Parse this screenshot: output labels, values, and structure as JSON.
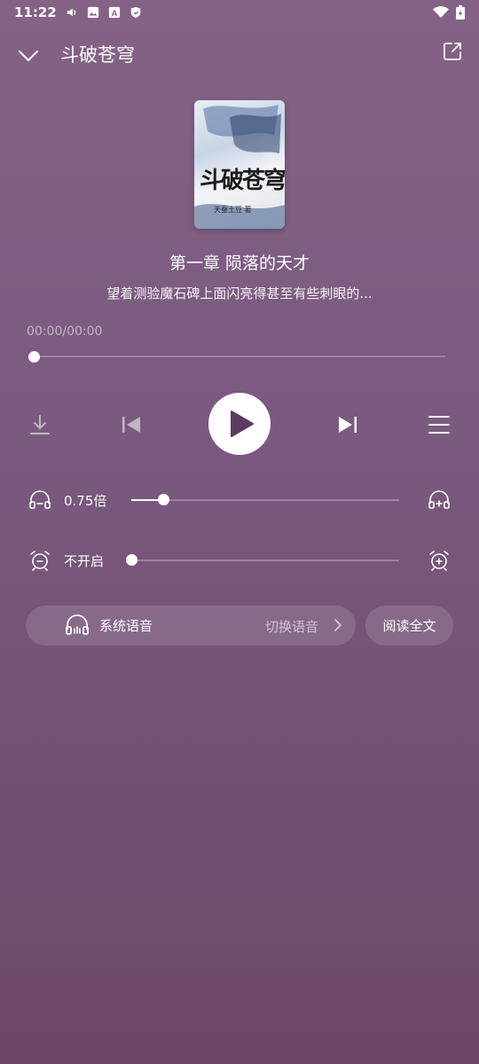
{
  "status": {
    "time": "11:22",
    "icons": [
      "volume-icon",
      "image-icon",
      "font-a-icon",
      "shield-icon"
    ],
    "right_icons": [
      "wifi-icon",
      "battery-icon"
    ]
  },
  "header": {
    "title": "斗破苍穹",
    "collapse_icon": "chevron-down-icon",
    "share_icon": "share-icon"
  },
  "book": {
    "cover_title": "斗破苍穹",
    "cover_author": "天蚕土豆 著"
  },
  "chapter": {
    "title": "第一章 陨落的天才",
    "excerpt": "望着测验魔石碑上面闪亮得甚至有些刺眼的..."
  },
  "playback": {
    "time": "00:00/00:00",
    "progress": 0
  },
  "speed": {
    "label": "0.75倍",
    "level": 0.12,
    "left_icon": "headphones-minus-icon",
    "right_icon": "headphones-plus-icon"
  },
  "timer": {
    "label": "不开启",
    "level": 0,
    "left_icon": "alarm-minus-icon",
    "right_icon": "alarm-plus-icon"
  },
  "voice": {
    "label": "系统语音",
    "switch_label": "切换语音",
    "icon": "headphones-icon"
  },
  "read_full": "阅读全文",
  "colors": {
    "bg_top": "#846286",
    "bg_bottom": "#6c4767",
    "foreground": "#ffffff"
  }
}
